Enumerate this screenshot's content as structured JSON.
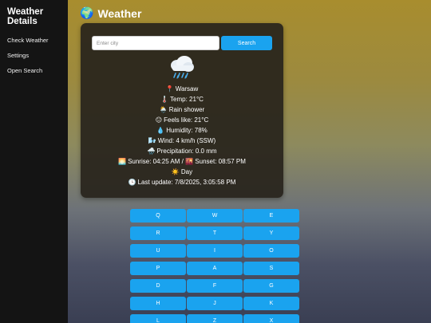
{
  "sidebar": {
    "title": "Weather Details",
    "items": [
      {
        "label": "Check Weather"
      },
      {
        "label": "Settings"
      },
      {
        "label": "Open Search"
      }
    ]
  },
  "header": {
    "icon": "globe-icon",
    "glyph": "🌍",
    "title": "Weather"
  },
  "search": {
    "placeholder": "Enter city",
    "value": "",
    "button_label": "Search"
  },
  "weather": {
    "icon": "rain-cloud-icon",
    "lines": [
      {
        "icon": "pin-icon",
        "glyph": "📍",
        "text": "Warsaw"
      },
      {
        "icon": "thermometer-icon",
        "glyph": "🌡️",
        "text": "Temp: 21°C"
      },
      {
        "icon": "sun-cloud-icon",
        "glyph": "🌦️",
        "text": "Rain shower"
      },
      {
        "icon": "face-icon",
        "glyph": "😐",
        "text": "Feels like: 21°C"
      },
      {
        "icon": "droplet-icon",
        "glyph": "💧",
        "text": "Humidity: 78%"
      },
      {
        "icon": "wind-icon",
        "glyph": "🌬️",
        "text": "Wind: 4 km/h (SSW)"
      },
      {
        "icon": "rain-icon",
        "glyph": "🌧️",
        "text": "Precipitation: 0.0 mm"
      },
      {
        "icon": "sunrise-icon",
        "glyph": "🌅",
        "text": "Sunrise: 04:25 AM / 🌇 Sunset: 08:57 PM"
      },
      {
        "icon": "sun-icon",
        "glyph": "☀️",
        "text": "Day"
      },
      {
        "icon": "clock-icon",
        "glyph": "🕒",
        "text": "Last update: 7/8/2025, 3:05:58 PM"
      }
    ]
  },
  "keyboard": {
    "rows": [
      [
        "Q",
        "W",
        "E"
      ],
      [
        "R",
        "T",
        "Y"
      ],
      [
        "U",
        "I",
        "O"
      ],
      [
        "P",
        "A",
        "S"
      ],
      [
        "D",
        "F",
        "G"
      ],
      [
        "H",
        "J",
        "K"
      ],
      [
        "L",
        "Z",
        "X"
      ]
    ]
  }
}
